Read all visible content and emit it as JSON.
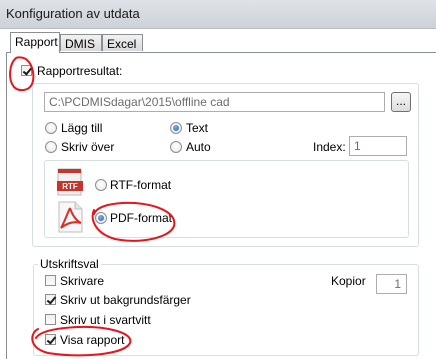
{
  "window": {
    "title": "Konfiguration av utdata"
  },
  "tabs": [
    {
      "label": "Rapport",
      "active": true
    },
    {
      "label": "DMIS",
      "active": false
    },
    {
      "label": "Excel",
      "active": false
    }
  ],
  "report": {
    "results_label": "Rapportresultat:",
    "results_checked": true,
    "path_value": "C:\\PCDMISdagar\\2015\\offline cad",
    "browse_label": "...",
    "append_label": "Lägg till",
    "overwrite_label": "Skriv över",
    "text_label": "Text",
    "auto_label": "Auto",
    "index_label": "Index:",
    "index_value": "1",
    "rtf_icon_text": "RTF",
    "rtf_label": "RTF-format",
    "pdf_label": "PDF-format",
    "selected_mode": "Text",
    "selected_format": "PDF-format"
  },
  "print": {
    "group_label": "Utskriftsval",
    "printer_label": "Skrivare",
    "background_label": "Skriv ut bakgrundsfärger",
    "bw_label": "Skriv ut i svartvitt",
    "show_report_label": "Visa rapport",
    "copies_label": "Kopior",
    "copies_value": "1",
    "printer_checked": false,
    "background_checked": true,
    "bw_checked": false,
    "show_report_checked": true
  },
  "colors": {
    "annotation": "#e8141c",
    "radio_selected": "#1c5db6",
    "rtf_icon": "#c6352b",
    "pdf_icon": "#d8302a"
  },
  "icons": {
    "rtf": "rtf-file-icon",
    "pdf": "pdf-file-icon"
  }
}
